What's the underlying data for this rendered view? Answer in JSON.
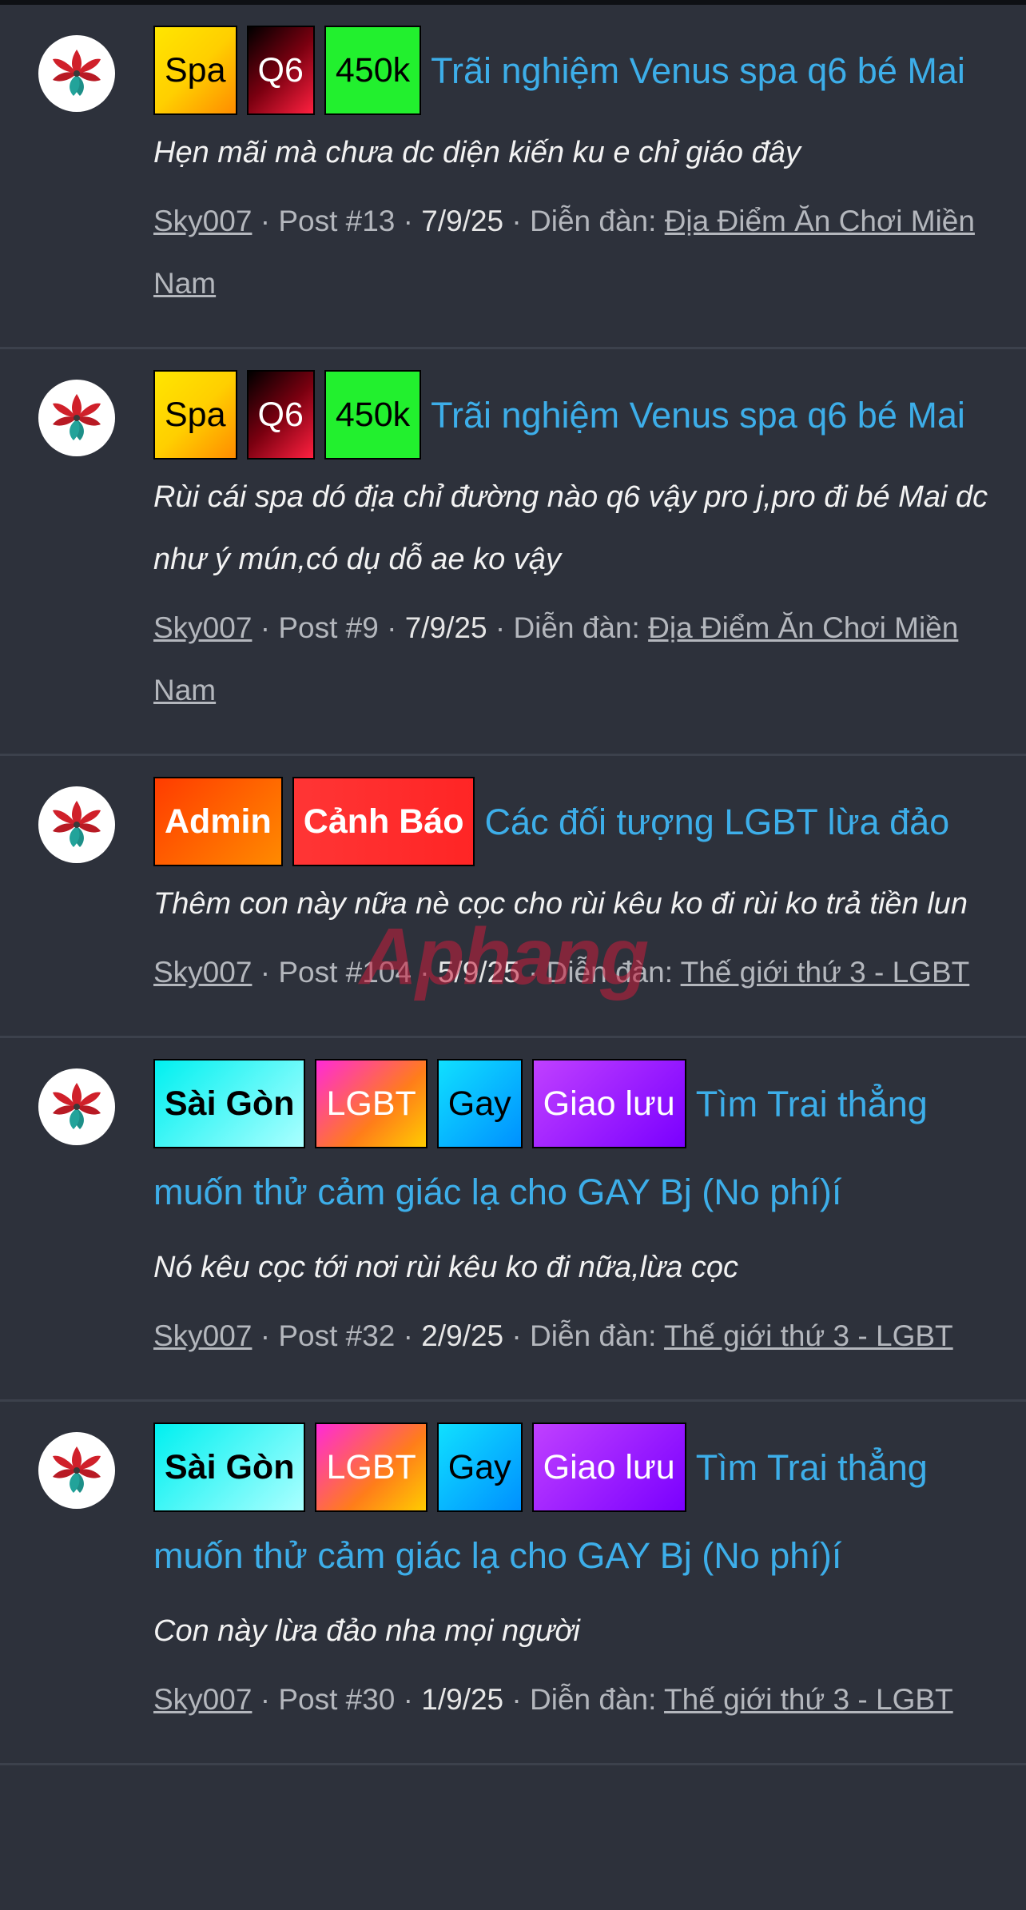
{
  "watermark": "Aphang",
  "results": [
    {
      "tags": [
        {
          "label": "Spa",
          "style": "spa"
        },
        {
          "label": "Q6",
          "style": "q6"
        },
        {
          "label": "450k",
          "style": "450"
        }
      ],
      "title": "Trãi nghiệm Venus spa q6 bé Mai",
      "snippet": "Hẹn mãi mà chưa dc diện kiến ku e chỉ giáo đây",
      "author": "Sky007",
      "post": "Post #13",
      "date": "7/9/25",
      "forum_label": "Diễn đàn:",
      "forum": "Địa Điểm Ăn Chơi Miền Nam"
    },
    {
      "tags": [
        {
          "label": "Spa",
          "style": "spa"
        },
        {
          "label": "Q6",
          "style": "q6"
        },
        {
          "label": "450k",
          "style": "450"
        }
      ],
      "title": "Trãi nghiệm Venus spa q6 bé Mai",
      "snippet": "Rùi cái spa dó địa chỉ đường nào q6 vậy pro j,pro đi bé Mai dc như ý mún,có dụ dỗ ae ko vậy",
      "author": "Sky007",
      "post": "Post #9",
      "date": "7/9/25",
      "forum_label": "Diễn đàn:",
      "forum": "Địa Điểm Ăn Chơi Miền Nam"
    },
    {
      "tags": [
        {
          "label": "Admin",
          "style": "admin"
        },
        {
          "label": "Cảnh Báo",
          "style": "canh"
        }
      ],
      "title": "Các đối tượng LGBT lừa đảo",
      "snippet": "Thêm con này nữa nè cọc cho rùi kêu ko đi rùi ko trả tiền lun",
      "author": "Sky007",
      "post": "Post #104",
      "date": "5/9/25",
      "forum_label": "Diễn đàn:",
      "forum": "Thế giới thứ 3 - LGBT"
    },
    {
      "tags": [
        {
          "label": "Sài Gòn",
          "style": "sg"
        },
        {
          "label": "LGBT",
          "style": "lgbt"
        },
        {
          "label": "Gay",
          "style": "gay"
        },
        {
          "label": "Giao lưu",
          "style": "gl"
        }
      ],
      "title": "Tìm Trai thẳng muốn thử cảm giác lạ cho GAY Bj (No phí)í",
      "snippet": "Nó kêu cọc tới nơi rùi kêu ko đi nữa,lừa cọc",
      "author": "Sky007",
      "post": "Post #32",
      "date": "2/9/25",
      "forum_label": "Diễn đàn:",
      "forum": "Thế giới thứ 3 - LGBT"
    },
    {
      "tags": [
        {
          "label": "Sài Gòn",
          "style": "sg"
        },
        {
          "label": "LGBT",
          "style": "lgbt"
        },
        {
          "label": "Gay",
          "style": "gay"
        },
        {
          "label": "Giao lưu",
          "style": "gl"
        }
      ],
      "title": "Tìm Trai thẳng muốn thử cảm giác lạ cho GAY Bj (No phí)í",
      "snippet": "Con này lừa đảo nha mọi người",
      "author": "Sky007",
      "post": "Post #30",
      "date": "1/9/25",
      "forum_label": "Diễn đàn:",
      "forum": "Thế giới thứ 3 - LGBT"
    }
  ]
}
